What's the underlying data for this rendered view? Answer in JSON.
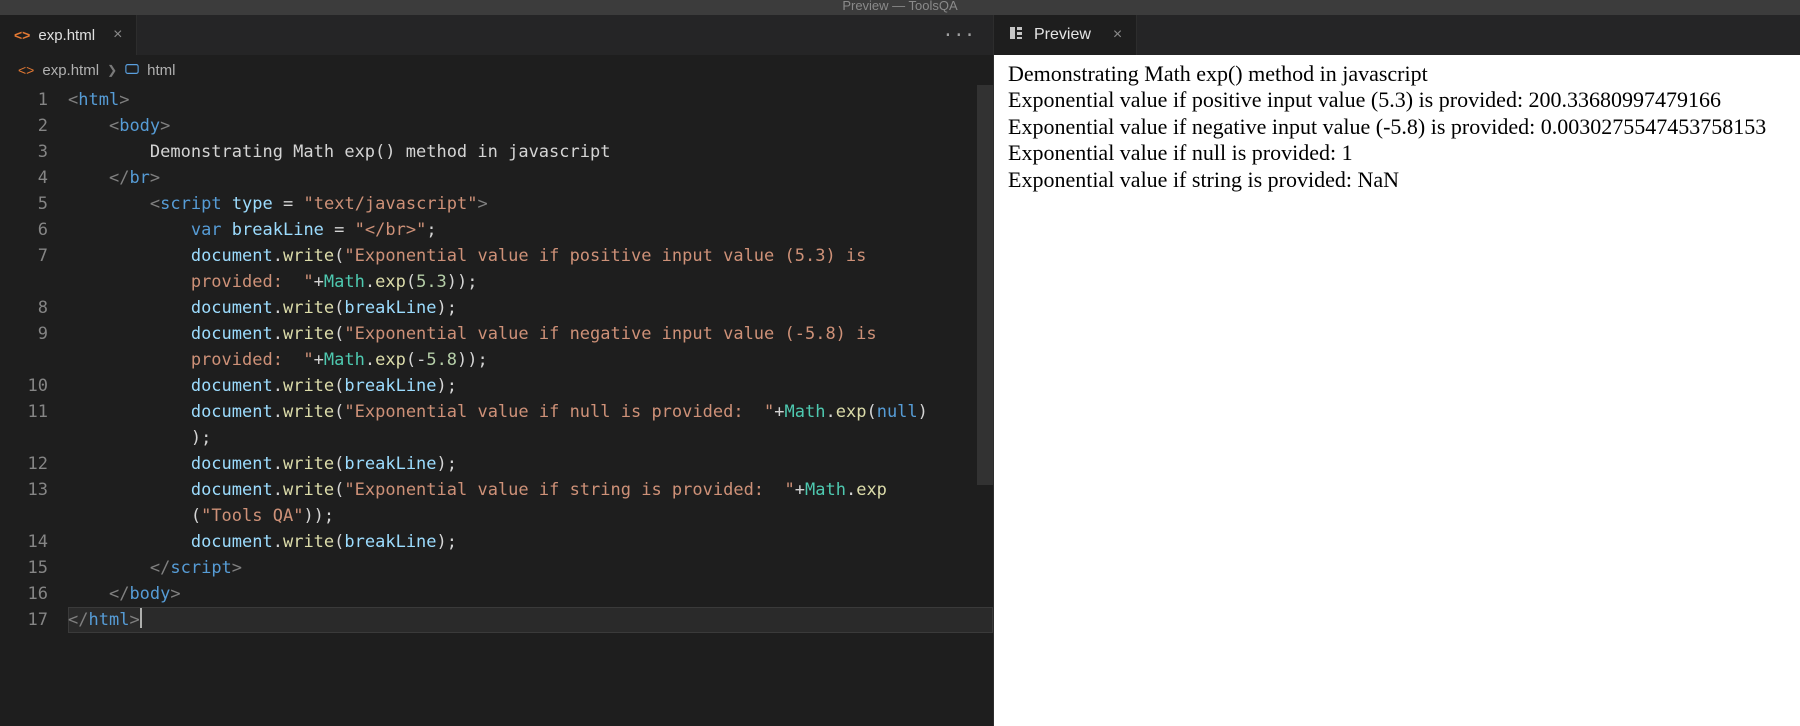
{
  "window": {
    "title": "Preview — ToolsQA"
  },
  "editor": {
    "tab": {
      "filename": "exp.html"
    },
    "breadcrumbs": {
      "file": "exp.html",
      "part": "html"
    }
  },
  "preview_tab": {
    "label": "Preview"
  },
  "code_tokens": {
    "l1": [
      [
        "brkt",
        "<"
      ],
      [
        "tag",
        "html"
      ],
      [
        "brkt",
        ">"
      ]
    ],
    "l2": [
      [
        "txt",
        "    "
      ],
      [
        "brkt",
        "<"
      ],
      [
        "tag",
        "body"
      ],
      [
        "brkt",
        ">"
      ]
    ],
    "l3": [
      [
        "txt",
        "        Demonstrating Math exp() method in javascript"
      ]
    ],
    "l4": [
      [
        "txt",
        "    "
      ],
      [
        "brkt",
        "</"
      ],
      [
        "tag",
        "br"
      ],
      [
        "brkt",
        ">"
      ]
    ],
    "l5": [
      [
        "txt",
        "        "
      ],
      [
        "brkt",
        "<"
      ],
      [
        "tag",
        "script"
      ],
      [
        "txt",
        " "
      ],
      [
        "attr",
        "type"
      ],
      [
        "txt",
        " "
      ],
      [
        "op",
        "="
      ],
      [
        "txt",
        " "
      ],
      [
        "str",
        "\"text/javascript\""
      ],
      [
        "brkt",
        ">"
      ]
    ],
    "l6": [
      [
        "txt",
        "            "
      ],
      [
        "tag",
        "var"
      ],
      [
        "txt",
        " "
      ],
      [
        "attr",
        "breakLine"
      ],
      [
        "txt",
        " "
      ],
      [
        "op",
        "="
      ],
      [
        "txt",
        " "
      ],
      [
        "str",
        "\"</br>\""
      ],
      [
        "op",
        ";"
      ]
    ],
    "l7a": [
      [
        "txt",
        "            "
      ],
      [
        "attr",
        "document"
      ],
      [
        "op",
        "."
      ],
      [
        "func",
        "write"
      ],
      [
        "op",
        "("
      ],
      [
        "str",
        "\"Exponential value if positive input value (5.3) is "
      ]
    ],
    "l7b": [
      [
        "txt",
        "            "
      ],
      [
        "str",
        "provided:  \""
      ],
      [
        "op",
        "+"
      ],
      [
        "obj",
        "Math"
      ],
      [
        "op",
        "."
      ],
      [
        "func",
        "exp"
      ],
      [
        "op",
        "("
      ],
      [
        "num",
        "5.3"
      ],
      [
        "op",
        "));"
      ]
    ],
    "l8": [
      [
        "txt",
        "            "
      ],
      [
        "attr",
        "document"
      ],
      [
        "op",
        "."
      ],
      [
        "func",
        "write"
      ],
      [
        "op",
        "("
      ],
      [
        "attr",
        "breakLine"
      ],
      [
        "op",
        ");"
      ]
    ],
    "l9a": [
      [
        "txt",
        "            "
      ],
      [
        "attr",
        "document"
      ],
      [
        "op",
        "."
      ],
      [
        "func",
        "write"
      ],
      [
        "op",
        "("
      ],
      [
        "str",
        "\"Exponential value if negative input value (-5.8) is "
      ]
    ],
    "l9b": [
      [
        "txt",
        "            "
      ],
      [
        "str",
        "provided:  \""
      ],
      [
        "op",
        "+"
      ],
      [
        "obj",
        "Math"
      ],
      [
        "op",
        "."
      ],
      [
        "func",
        "exp"
      ],
      [
        "op",
        "("
      ],
      [
        "op",
        "-"
      ],
      [
        "num",
        "5.8"
      ],
      [
        "op",
        "));"
      ]
    ],
    "l10": [
      [
        "txt",
        "            "
      ],
      [
        "attr",
        "document"
      ],
      [
        "op",
        "."
      ],
      [
        "func",
        "write"
      ],
      [
        "op",
        "("
      ],
      [
        "attr",
        "breakLine"
      ],
      [
        "op",
        ");"
      ]
    ],
    "l11a": [
      [
        "txt",
        "            "
      ],
      [
        "attr",
        "document"
      ],
      [
        "op",
        "."
      ],
      [
        "func",
        "write"
      ],
      [
        "op",
        "("
      ],
      [
        "str",
        "\"Exponential value if null is provided:  \""
      ],
      [
        "op",
        "+"
      ],
      [
        "obj",
        "Math"
      ],
      [
        "op",
        "."
      ],
      [
        "func",
        "exp"
      ],
      [
        "op",
        "("
      ],
      [
        "null",
        "null"
      ],
      [
        "op",
        ")"
      ]
    ],
    "l11b": [
      [
        "txt",
        "            "
      ],
      [
        "op",
        ");"
      ]
    ],
    "l12": [
      [
        "txt",
        "            "
      ],
      [
        "attr",
        "document"
      ],
      [
        "op",
        "."
      ],
      [
        "func",
        "write"
      ],
      [
        "op",
        "("
      ],
      [
        "attr",
        "breakLine"
      ],
      [
        "op",
        ");"
      ]
    ],
    "l13a": [
      [
        "txt",
        "            "
      ],
      [
        "attr",
        "document"
      ],
      [
        "op",
        "."
      ],
      [
        "func",
        "write"
      ],
      [
        "op",
        "("
      ],
      [
        "str",
        "\"Exponential value if string is provided:  \""
      ],
      [
        "op",
        "+"
      ],
      [
        "obj",
        "Math"
      ],
      [
        "op",
        "."
      ],
      [
        "func",
        "exp"
      ]
    ],
    "l13b": [
      [
        "txt",
        "            "
      ],
      [
        "op",
        "("
      ],
      [
        "str",
        "\"Tools QA\""
      ],
      [
        "op",
        "));"
      ]
    ],
    "l14": [
      [
        "txt",
        "            "
      ],
      [
        "attr",
        "document"
      ],
      [
        "op",
        "."
      ],
      [
        "func",
        "write"
      ],
      [
        "op",
        "("
      ],
      [
        "attr",
        "breakLine"
      ],
      [
        "op",
        ");"
      ]
    ],
    "l15": [
      [
        "txt",
        "        "
      ],
      [
        "brkt",
        "</"
      ],
      [
        "tag",
        "script"
      ],
      [
        "brkt",
        ">"
      ]
    ],
    "l16": [
      [
        "txt",
        "    "
      ],
      [
        "brkt",
        "</"
      ],
      [
        "tag",
        "body"
      ],
      [
        "brkt",
        ">"
      ]
    ],
    "l17": [
      [
        "brkt",
        "</"
      ],
      [
        "tag",
        "html"
      ],
      [
        "brkt",
        ">"
      ]
    ]
  },
  "gutter": [
    "1",
    "2",
    "3",
    "4",
    "5",
    "6",
    "7",
    "",
    "8",
    "9",
    "",
    "10",
    "11",
    "",
    "12",
    "13",
    "",
    "14",
    "15",
    "16",
    "17"
  ],
  "preview_output": [
    "Demonstrating Math exp() method in javascript",
    "Exponential value if positive input value (5.3) is provided: 200.33680997479166",
    "Exponential value if negative input value (-5.8) is provided: 0.0030275547453758153",
    "Exponential value if null is provided: 1",
    "Exponential value if string is provided: NaN"
  ]
}
